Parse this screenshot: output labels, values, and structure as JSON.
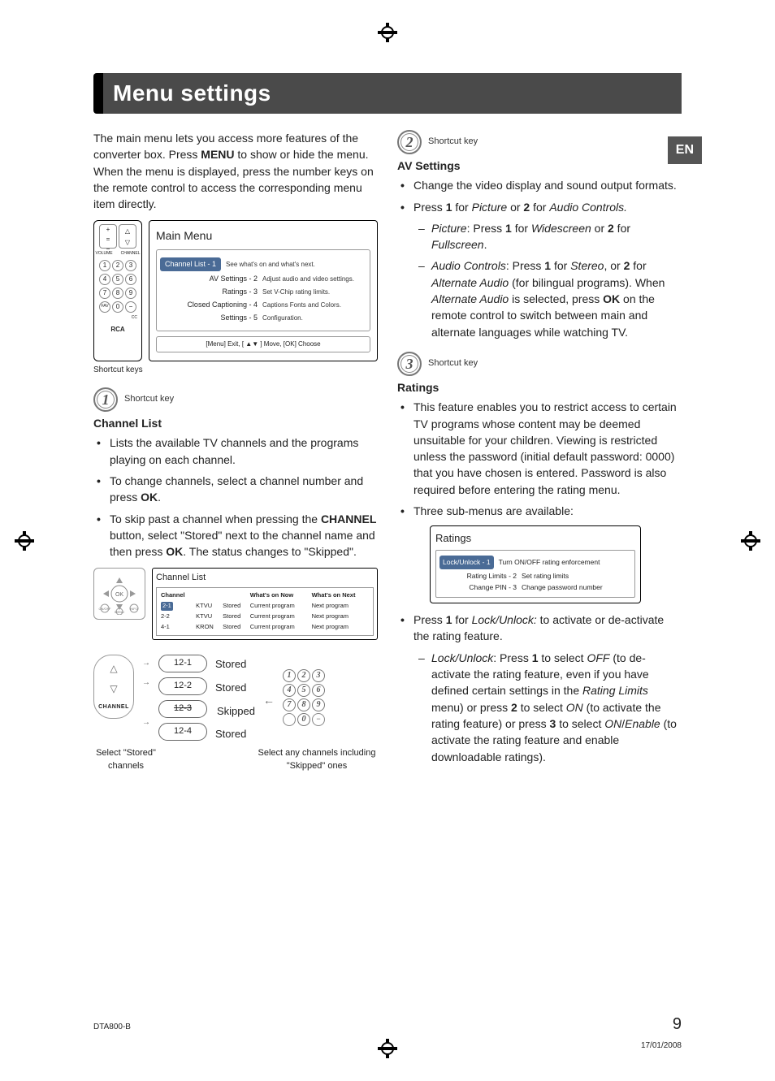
{
  "lang_tab": "EN",
  "title": "Menu settings",
  "intro_parts": {
    "a": "The main menu lets you access more features of the converter box. Press ",
    "menu": "MENU",
    "b": " to show or hide the menu. When the menu is displayed, press the number keys on the remote control to access the corresponding menu item directly."
  },
  "remote": {
    "volume_label": "VOLUME",
    "channel_label": "CHANNEL",
    "brand": "RCA",
    "fav": "FAV",
    "cc": "CC"
  },
  "main_menu": {
    "title": "Main Menu",
    "rows": [
      {
        "label": "Channel List - 1",
        "desc": "See what's on and what's next.",
        "selected": true
      },
      {
        "label": "AV Settings - 2",
        "desc": "Adjust audio and video settings."
      },
      {
        "label": "Ratings - 3",
        "desc": "Set V-Chip rating limits."
      },
      {
        "label": "Closed Captioning - 4",
        "desc": "Captions Fonts and Colors."
      },
      {
        "label": "Settings - 5",
        "desc": "Configuration."
      }
    ],
    "footer": "[Menu] Exit, [ ▲▼ ] Move, [OK] Choose",
    "caption": "Shortcut keys"
  },
  "shortcut_label": "Shortcut key",
  "sections": {
    "channel_list": {
      "heading": "Channel List",
      "bullets": [
        "Lists the available TV channels and the programs playing on each channel.",
        "To change channels, select a channel number and press <b>OK</b>.",
        "To skip past a channel when pressing the <b>CHANNEL</b> button, select \"Stored\" next to the channel name and then press <b>OK</b>. The status changes to \"Skipped\"."
      ]
    },
    "av": {
      "heading": "AV Settings",
      "bullet1": "Change the video display and sound output formats.",
      "bullet2_a": "Press ",
      "bullet2_one": "1",
      "bullet2_b": " for ",
      "bullet2_picture": "Picture",
      "bullet2_c": " or ",
      "bullet2_two": "2",
      "bullet2_d": " for ",
      "bullet2_audio": "Audio Controls.",
      "picture_a": "Picture",
      "picture_b": ": Press ",
      "picture_one": "1",
      "picture_c": " for ",
      "picture_ws": "Widescreen",
      "picture_d": " or ",
      "picture_two": "2",
      "picture_e": " for ",
      "picture_fs": "Fullscreen",
      "picture_f": ".",
      "audio_a": "Audio Controls",
      "audio_b": ": Press ",
      "audio_one": "1",
      "audio_c": " for ",
      "audio_stereo": "Stereo",
      "audio_d": ", or ",
      "audio_two": "2",
      "audio_e": " for ",
      "audio_alt": "Alternate Audio",
      "audio_f": " (for bilingual programs). When ",
      "audio_alt2": "Alternate Audio",
      "audio_g": " is selected, press ",
      "audio_ok": "OK",
      "audio_h": " on the remote control to switch between main and alternate languages while watching TV."
    },
    "ratings": {
      "heading": "Ratings",
      "bullet1": "This feature enables you to restrict access to certain TV programs whose content may be deemed unsuitable for your children. Viewing is restricted unless the password (initial default password: 0000) that you have chosen is entered. Password is also required before entering the rating menu.",
      "bullet2": "Three sub-menus are available:",
      "bullet3_a": "Press ",
      "bullet3_one": "1",
      "bullet3_b": " for ",
      "bullet3_lu": "Lock/Unlock:",
      "bullet3_c": " to activate or de-activate the rating feature.",
      "dash_a": "Lock/Unlock",
      "dash_b": ": Press ",
      "dash_one": "1",
      "dash_c": " to select ",
      "dash_off": "OFF",
      "dash_d": " (to de-activate the rating feature, even if you have defined certain settings in the ",
      "dash_rl": "Rating Limits",
      "dash_e": " menu) or press ",
      "dash_two": "2",
      "dash_f": " to select ",
      "dash_on": "ON",
      "dash_g": " (to activate the rating feature) or press ",
      "dash_three": "3",
      "dash_h": " to select ",
      "dash_on2": "ON",
      "dash_slash": "/",
      "dash_enable": "Enable",
      "dash_i": " (to activate the rating feature and enable downloadable ratings)."
    }
  },
  "channel_list_panel": {
    "title": "Channel List",
    "headers": [
      "Channel",
      "",
      "",
      "What's on Now",
      "What's on Next"
    ],
    "rows": [
      [
        "2-1",
        "KTVU",
        "Stored",
        "Current program",
        "Next program"
      ],
      [
        "2-2",
        "KTVU",
        "Stored",
        "Current program",
        "Next program"
      ],
      [
        "4-1",
        "KRON",
        "Stored",
        "Current program",
        "Next program"
      ]
    ]
  },
  "stored_diag": {
    "channel_btn": "CHANNEL",
    "ovals": [
      "12-1",
      "12-2",
      "12-3",
      "12-4"
    ],
    "statuses": [
      "Stored",
      "Stored",
      "Skipped",
      "Stored"
    ],
    "left_note": "Select \"Stored\" channels",
    "right_note": "Select any channels including \"Skipped\" ones"
  },
  "ratings_panel": {
    "title": "Ratings",
    "rows": [
      {
        "label": "Lock/Unlock - 1",
        "desc": "Turn ON/OFF rating enforcement",
        "selected": true
      },
      {
        "label": "Rating Limits - 2",
        "desc": "Set rating limits"
      },
      {
        "label": "Change PIN - 3",
        "desc": "Change password number"
      }
    ]
  },
  "shortcut_numbers": {
    "one": "1",
    "two": "2",
    "three": "3"
  },
  "footer": {
    "model": "DTA800-B",
    "page": "9",
    "date": "17/01/2008"
  }
}
